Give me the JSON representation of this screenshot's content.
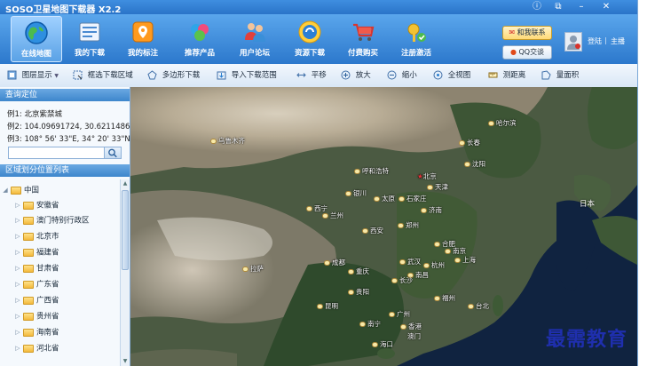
{
  "app": {
    "title": "SOSO卫星地图下载器 X2.2"
  },
  "window_controls": [
    {
      "name": "info",
      "symbol": "ⓘ"
    },
    {
      "name": "restore",
      "symbol": "⧉"
    },
    {
      "name": "minimize",
      "symbol": "–"
    },
    {
      "name": "close",
      "symbol": "✕"
    }
  ],
  "nav": [
    {
      "label": "在线地图",
      "icon": "globe-icon",
      "active": true
    },
    {
      "label": "我的下载",
      "icon": "download-list-icon",
      "active": false
    },
    {
      "label": "我的标注",
      "icon": "map-pin-icon",
      "active": false
    },
    {
      "label": "推荐产品",
      "icon": "products-icon",
      "active": false
    },
    {
      "label": "用户论坛",
      "icon": "users-icon",
      "active": false
    },
    {
      "label": "资源下载",
      "icon": "resource-icon",
      "active": false
    },
    {
      "label": "付费购买",
      "icon": "cart-icon",
      "active": false
    },
    {
      "label": "注册激活",
      "icon": "register-icon",
      "active": false
    }
  ],
  "contact": {
    "email": "和我联系",
    "qq": "QQ交谈"
  },
  "account": {
    "login": "登陆",
    "separator": "|",
    "home": "主播"
  },
  "toolbar": [
    {
      "label": "图层显示",
      "icon": "layers-icon",
      "dropdown": true
    },
    {
      "label": "框选下载区域",
      "icon": "select-rect-icon"
    },
    {
      "label": "多边形下载",
      "icon": "polygon-icon"
    },
    {
      "label": "导入下载范围",
      "icon": "import-icon"
    },
    {
      "label": "平移",
      "icon": "pan-icon"
    },
    {
      "label": "放大",
      "icon": "zoom-in-icon"
    },
    {
      "label": "缩小",
      "icon": "zoom-out-icon"
    },
    {
      "label": "全视图",
      "icon": "full-view-icon"
    },
    {
      "label": "测距离",
      "icon": "ruler-icon"
    },
    {
      "label": "量面积",
      "icon": "area-icon"
    }
  ],
  "sidebar": {
    "query_title": "查询定位",
    "examples": [
      "例1: 北京紫禁城",
      "例2: 104.09691724, 30.62114865",
      "例3: 108° 56' 33\"E, 34° 20' 33\"N"
    ],
    "search": {
      "value": "",
      "placeholder": ""
    },
    "region_title": "区域划分位置列表",
    "tree_root": "中国",
    "provinces": [
      "安徽省",
      "澳门特别行政区",
      "北京市",
      "福建省",
      "甘肃省",
      "广东省",
      "广西省",
      "贵州省",
      "海南省",
      "河北省"
    ]
  },
  "map": {
    "cities": [
      "哈尔滨",
      "长春",
      "乌鲁木齐",
      "沈阳",
      "呼和浩特",
      "北京",
      "天津",
      "银川",
      "太原",
      "石家庄",
      "济南",
      "西宁",
      "兰州",
      "郑州",
      "西安",
      "合肥",
      "南京",
      "上海",
      "武汉",
      "杭州",
      "成都",
      "重庆",
      "南昌",
      "长沙",
      "福州",
      "拉萨",
      "贵阳",
      "昆明",
      "台北",
      "广州",
      "香港",
      "南宁",
      "澳门",
      "海口"
    ],
    "labels": {
      "japan": "日本"
    }
  },
  "watermark": "最需教育",
  "colors": {
    "titlebar": "#2a74c8",
    "ribbon": "#3d8ad8",
    "panel_header": "#3d86cc",
    "watermark": "#1f2fae"
  }
}
